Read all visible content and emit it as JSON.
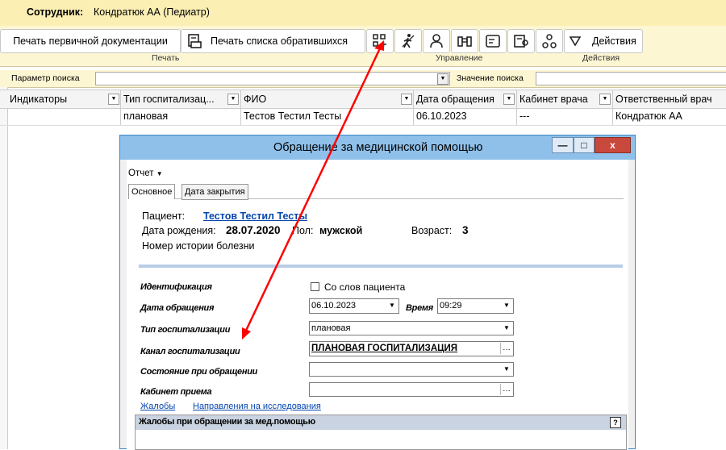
{
  "header": {
    "employee_label": "Сотрудник:",
    "employee_value": "Кондратюк АА (Педиатр)"
  },
  "ribbon": {
    "print_primary": "Печать первичной документации",
    "print_list": "Печать списка обратившихся",
    "actions_label": "Действия",
    "group_print": "Печать",
    "group_manage": "Управление",
    "group_actions": "Действия"
  },
  "search": {
    "param_label": "Параметр поиска",
    "value_label": "Значение поиска"
  },
  "grid": {
    "columns": [
      "Индикаторы",
      "Тип госпитализац...",
      "ФИО",
      "Дата обращения",
      "Кабинет врача",
      "Ответственный врач"
    ],
    "rows": [
      [
        "",
        "плановая",
        "Тестов Тестил Тесты",
        "06.10.2023",
        "---",
        "Кондратюк АА"
      ]
    ]
  },
  "dialog": {
    "title": "Обращение за медицинской помощью",
    "menu_report": "Отчет",
    "tabs": [
      "Основное",
      "Дата закрытия"
    ],
    "patient_label": "Пациент:",
    "patient_name": "Тестов Тестил Тесты",
    "birth_label": "Дата рождения:",
    "birth_value": "28.07.2020",
    "sex_label": "Пол:",
    "sex_value": "мужской",
    "age_label": "Возраст:",
    "age_value": "3",
    "history_label": "Номер истории болезни",
    "ident_label": "Идентификация",
    "from_patient_label": "Со слов пациента",
    "date_label": "Дата обращения",
    "date_value": "06.10.2023",
    "time_label": "Время",
    "time_value": "09:29",
    "hosp_type_label": "Тип госпитализации",
    "hosp_type_value": "плановая",
    "channel_label": "Канал госпитализации",
    "channel_value": "ПЛАНОВАЯ ГОСПИТАЛИЗАЦИЯ",
    "state_label": "Состояние при обращении",
    "state_value": "",
    "cabinet_label": "Кабинет приема",
    "cabinet_value": "",
    "link_complaints": "Жалобы",
    "link_directions": "Направления на исследования",
    "complaints_header": "Жалобы при обращении за мед.помощью"
  },
  "colors": {
    "arrow": "#ff0000",
    "title_bar": "#8ec0ea",
    "close_button": "#c9483c",
    "ribbon_bg": "#fdf6d3"
  }
}
